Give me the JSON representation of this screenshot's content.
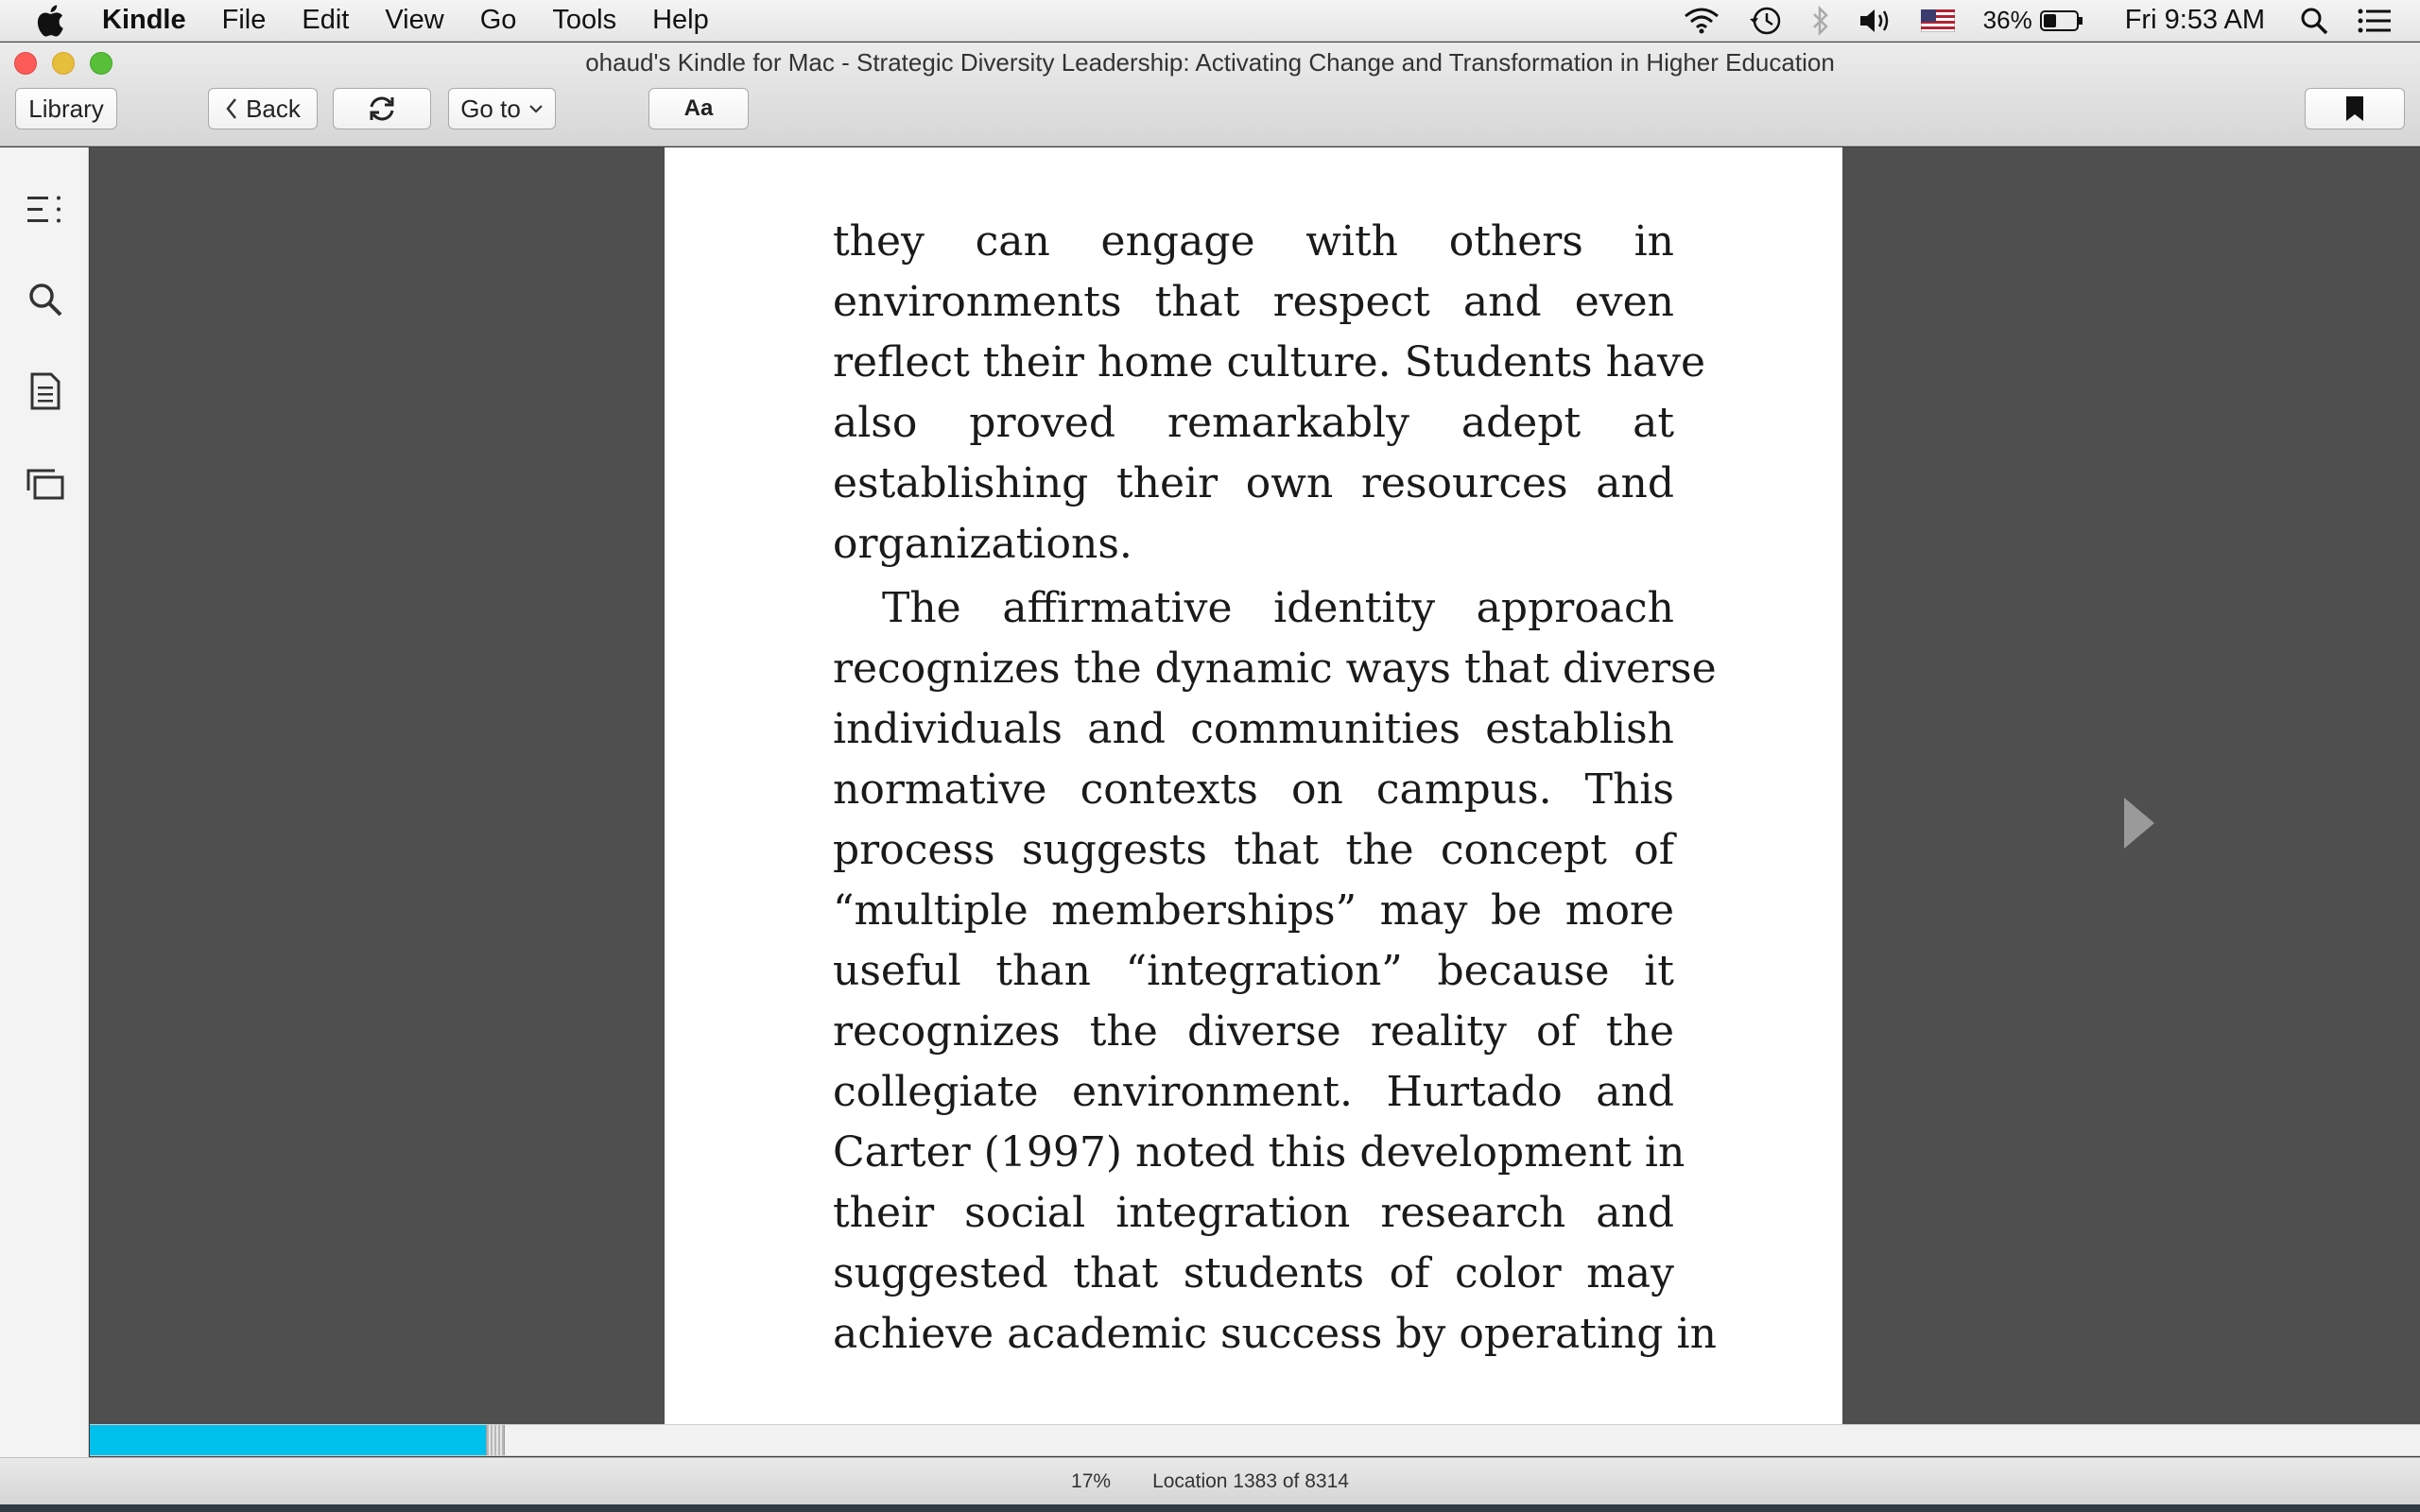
{
  "menubar": {
    "app_name": "Kindle",
    "items": [
      "File",
      "Edit",
      "View",
      "Go",
      "Tools",
      "Help"
    ],
    "battery_percent": "36%",
    "clock": "Fri 9:53 AM"
  },
  "window": {
    "title": "ohaud's Kindle for Mac - Strategic Diversity Leadership: Activating Change and Transformation in Higher Education"
  },
  "toolbar": {
    "library_label": "Library",
    "back_label": "Back",
    "goto_label": "Go to",
    "font_label": "Aa"
  },
  "sidebar": {
    "icons": [
      "table-of-contents-icon",
      "search-icon",
      "notes-icon",
      "flashcards-icon"
    ]
  },
  "book": {
    "lines": [
      "they can engage with others in",
      "environments that respect and even",
      "reflect their home culture. Students have",
      "also proved remarkably adept at",
      "establishing their own resources and",
      "organizations.",
      "The affirmative identity approach",
      "recognizes the dynamic ways that diverse",
      "individuals and communities establish",
      "normative contexts on campus. This",
      "process suggests that the concept of",
      "“multiple memberships” may be more",
      "useful than “integration” because it",
      "recognizes the diverse reality of the",
      "collegiate environment. Hurtado and",
      "Carter (1997) noted this development in",
      "their social integration research and",
      "suggested that students of color may",
      "achieve academic success by operating in"
    ]
  },
  "progress": {
    "fraction": 0.17,
    "percent_label": "17%",
    "location_label": "Location 1383 of 8314"
  },
  "colors": {
    "progress_fill": "#00c1ec",
    "reader_background": "#4f4f4f",
    "page_background": "#ffffff"
  }
}
